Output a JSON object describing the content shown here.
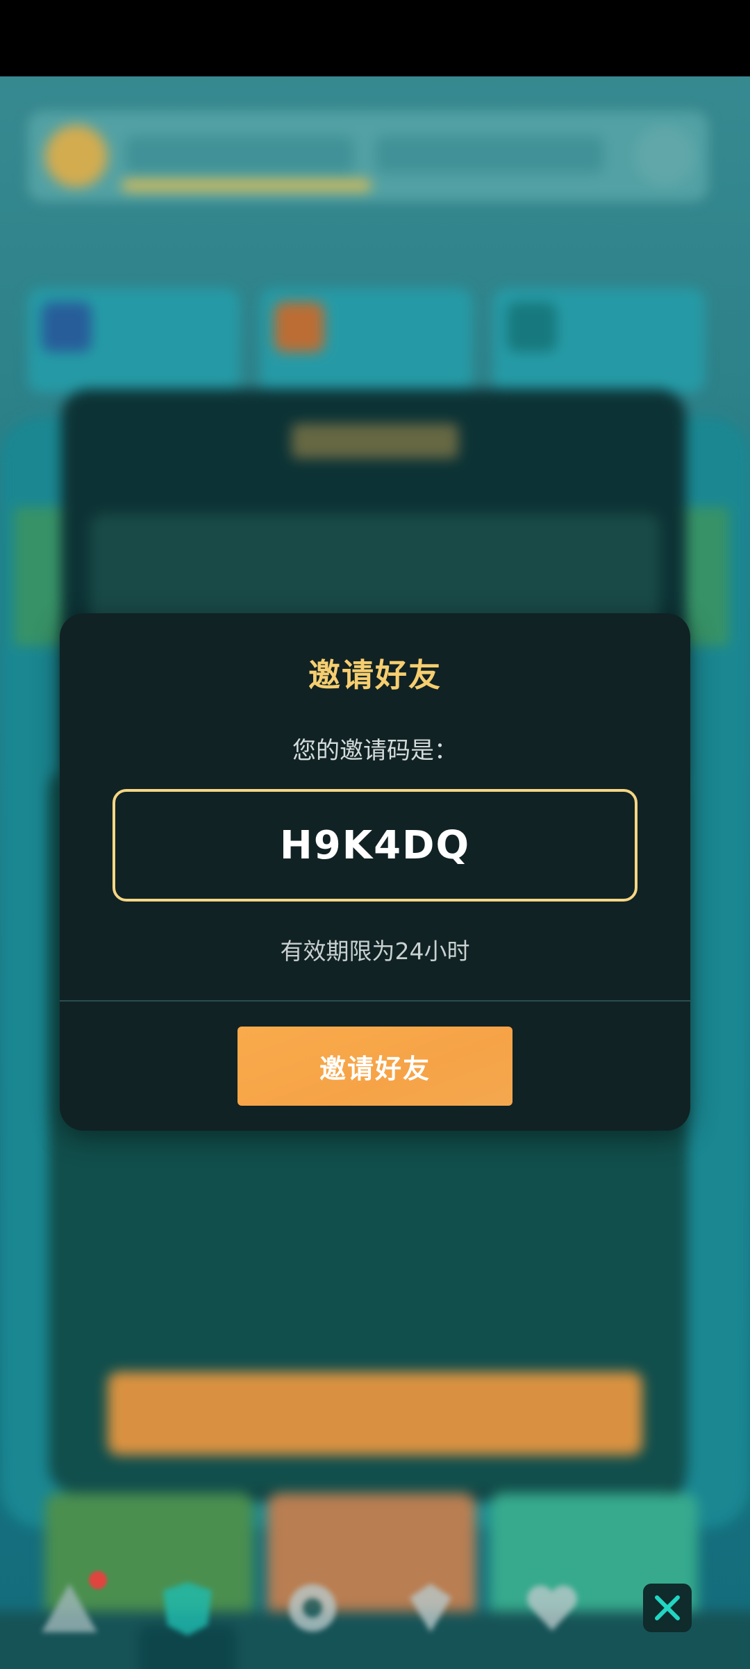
{
  "modal": {
    "title": "邀请好友",
    "code_label": "您的邀请码是：",
    "code": "H9K4DQ",
    "expiry_text": "有效期限为24小时",
    "invite_button_label": "邀请好友"
  },
  "colors": {
    "accent_gold": "#f6ce70",
    "button_orange": "#f9ab4b",
    "modal_bg": "#112224",
    "code_border": "#f5d684"
  },
  "icons": {
    "close": "close-x-icon",
    "nav": [
      "home-icon",
      "shield-icon",
      "gear-icon",
      "gem-icon",
      "heart-icon"
    ]
  }
}
